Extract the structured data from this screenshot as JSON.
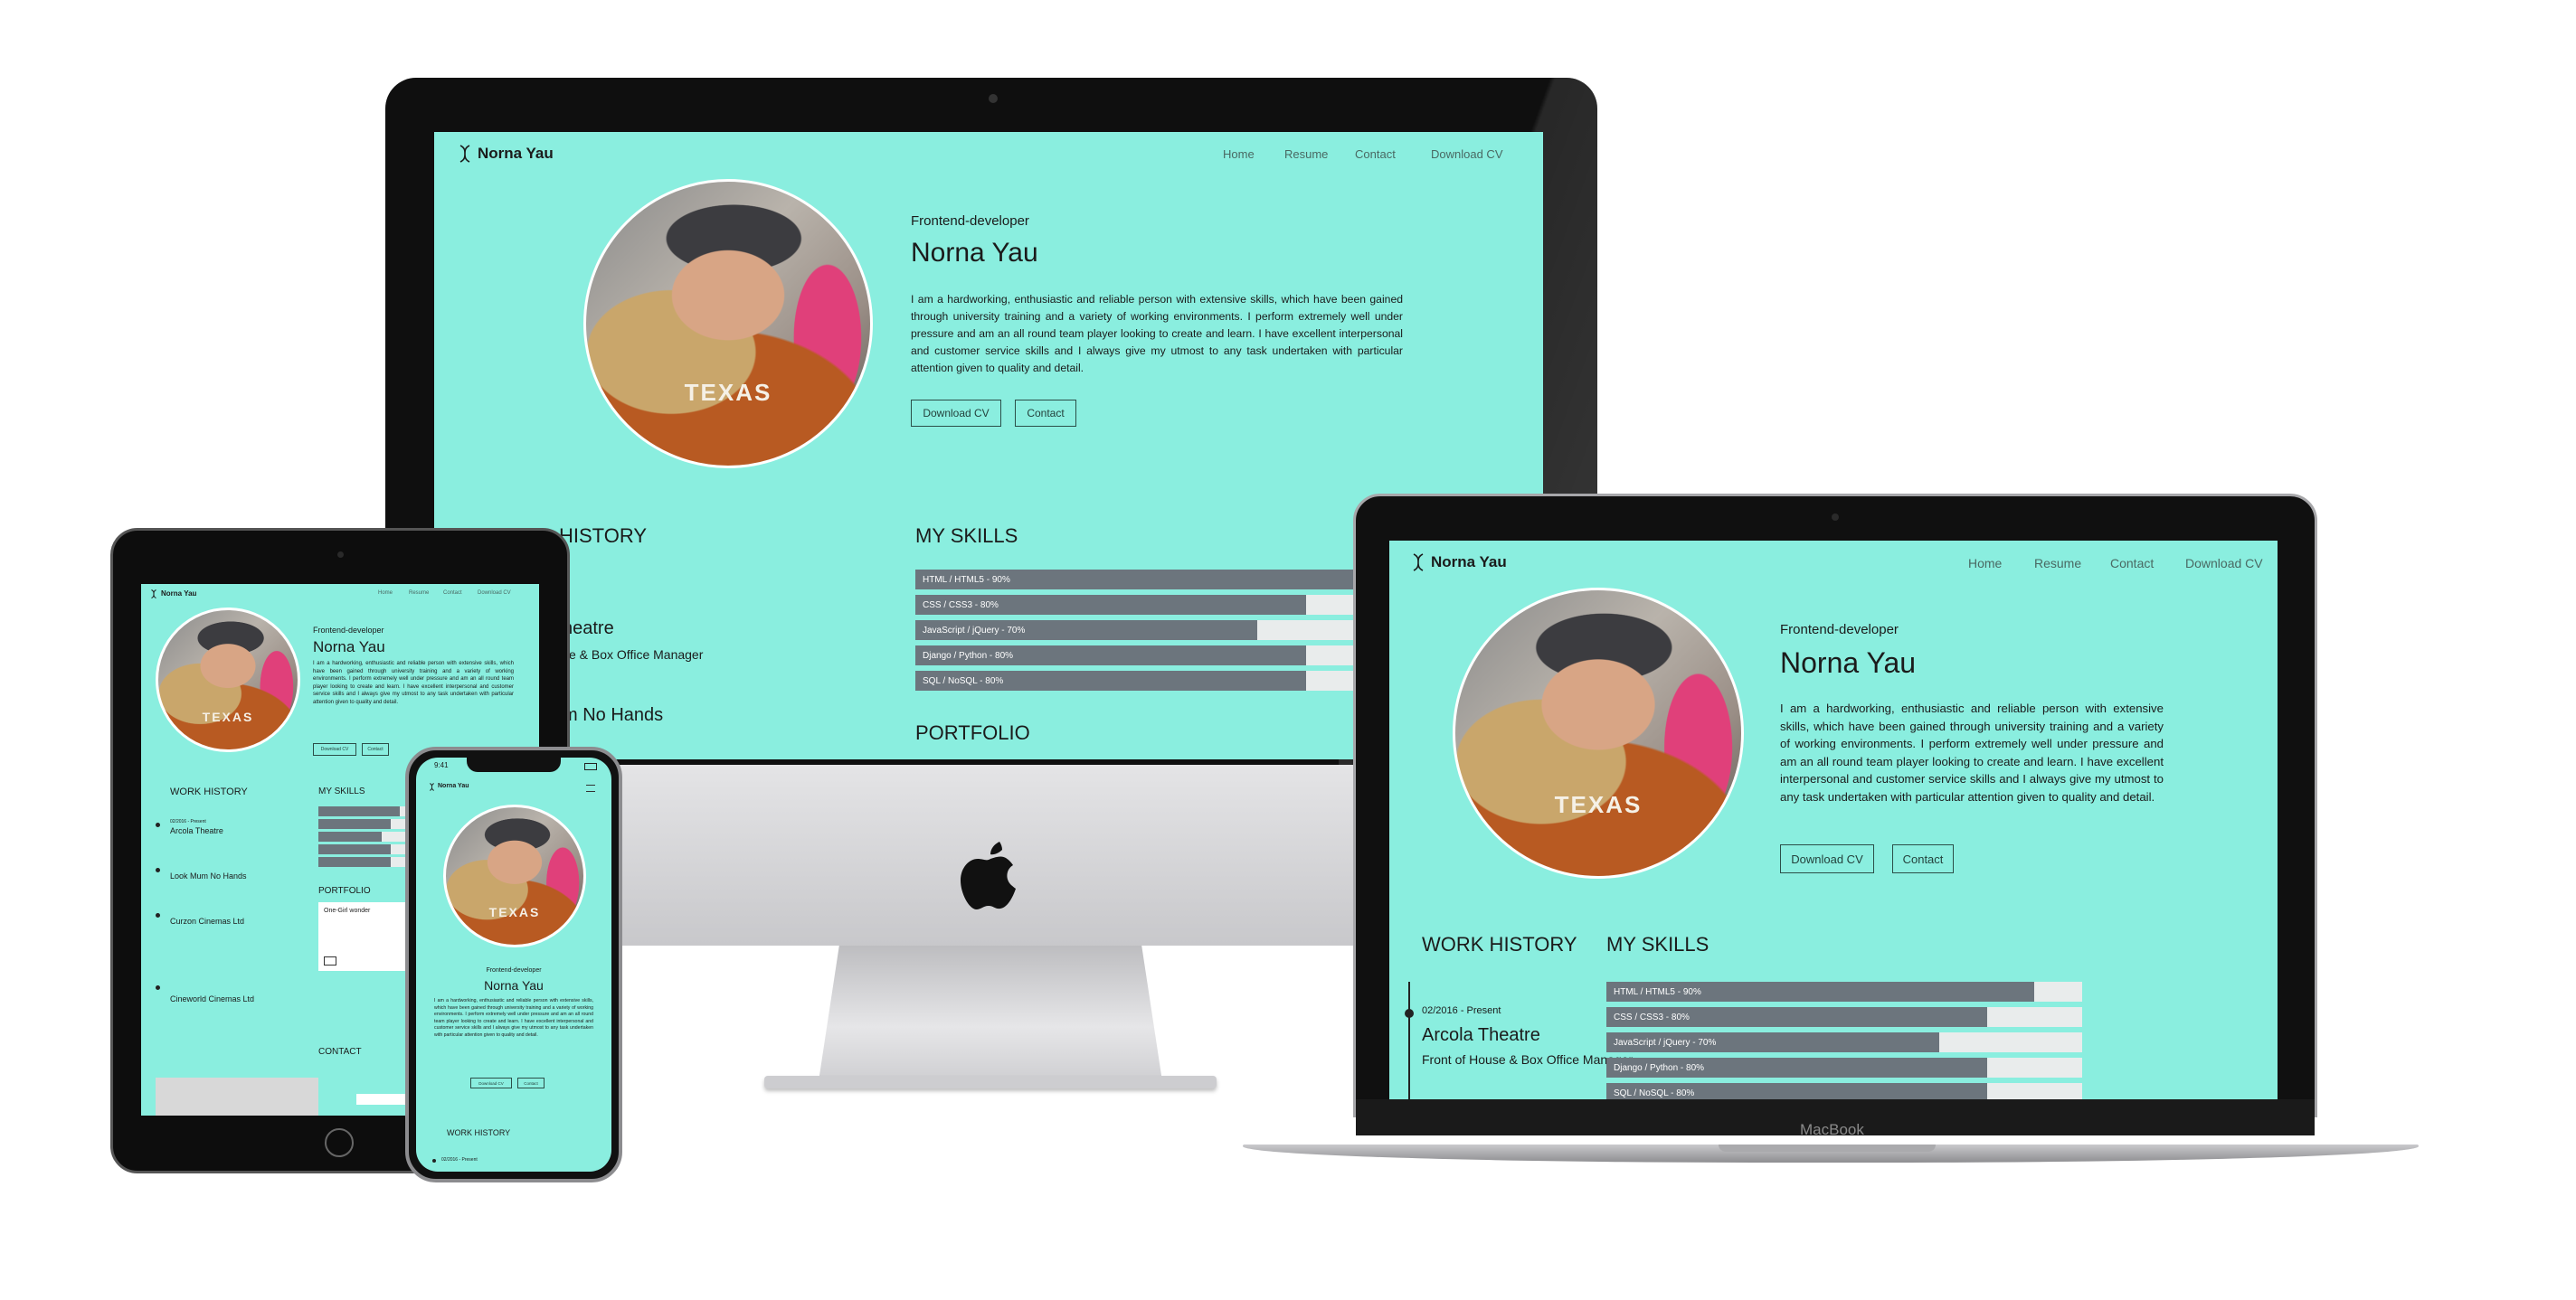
{
  "site": {
    "logo_icon": "dna-icon",
    "name": "Norna Yau",
    "nav": [
      "Home",
      "Resume",
      "Contact",
      "Download CV"
    ],
    "role": "Frontend-developer",
    "heading": "Norna Yau",
    "bio": "I am a hardworking, enthusiastic and reliable person with extensive skills, which have been gained through university training and a variety of working environments. I perform extremely well under pressure and am an all round team player looking to create and learn. I have excellent interpersonal and customer service skills and I always give my utmost to any task undertaken with particular attention given to quality and detail.",
    "download_button": "Download CV",
    "contact_button": "Contact",
    "photo_text": "TEXAS",
    "work_history_title": "WORK HISTORY",
    "skills_title": "MY SKILLS",
    "portfolio_title": "PORTFOLIO",
    "contact_title": "CONTACT",
    "skills": [
      {
        "label": "HTML / HTML5 - 90%",
        "percent": 90
      },
      {
        "label": "CSS / CSS3 - 80%",
        "percent": 80
      },
      {
        "label": "JavaScript / jQuery - 70%",
        "percent": 70
      },
      {
        "label": "Django / Python - 80%",
        "percent": 80
      },
      {
        "label": "SQL / NoSQL - 80%",
        "percent": 80
      }
    ],
    "jobs": [
      {
        "date": "02/2016 - Present",
        "company": "Arcola Theatre",
        "role": "Front of House & Box Office Manager"
      },
      {
        "company": "Look Mum No Hands"
      },
      {
        "company": "Curzon Cinemas Ltd"
      },
      {
        "company": "Cineworld Cinemas Ltd"
      }
    ],
    "portfolio_item": "One-Girl wonder",
    "imac_partial": {
      "history": "HISTORY",
      "company": "heatre",
      "role": "se & Box Office Manager",
      "company2": "m No Hands"
    }
  },
  "devices": {
    "laptop_brand": "MacBook",
    "phone_time": "9:41"
  }
}
